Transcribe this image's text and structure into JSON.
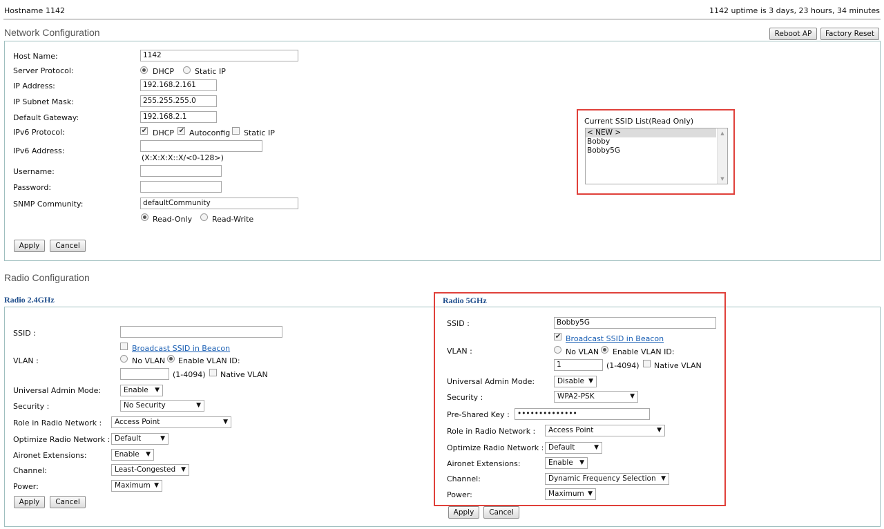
{
  "header": {
    "hostname_label": "Hostname",
    "hostname_value": "1142",
    "uptime": "1142 uptime is 3 days, 23 hours, 34 minutes"
  },
  "network": {
    "title": "Network Configuration",
    "reboot_label": "Reboot AP",
    "factory_reset_label": "Factory Reset",
    "host_name_label": "Host Name:",
    "host_name_value": "1142",
    "server_protocol_label": "Server Protocol:",
    "dhcp_label": "DHCP",
    "static_ip_label": "Static IP",
    "ip_address_label": "IP Address:",
    "ip_address_value": "192.168.2.161",
    "subnet_label": "IP Subnet Mask:",
    "subnet_value": "255.255.255.0",
    "gateway_label": "Default Gateway:",
    "gateway_value": "192.168.2.1",
    "ipv6_protocol_label": "IPv6 Protocol:",
    "ipv6_dhcp_label": "DHCP",
    "ipv6_autoconfig_label": "Autoconfig",
    "ipv6_static_label": "Static IP",
    "ipv6_address_label": "IPv6 Address:",
    "ipv6_address_value": "",
    "ipv6_hint": "(X:X:X:X::X/<0-128>)",
    "username_label": "Username:",
    "username_value": "",
    "password_label": "Password:",
    "password_value": "",
    "snmp_label": "SNMP Community:",
    "snmp_value": "defaultCommunity",
    "read_only_label": "Read-Only",
    "read_write_label": "Read-Write",
    "apply_label": "Apply",
    "cancel_label": "Cancel",
    "ssid_list_label": "Current SSID List(Read Only)",
    "ssid_list": [
      "< NEW >",
      "Bobby",
      "Bobby5G"
    ]
  },
  "radio": {
    "title": "Radio Configuration",
    "r24": {
      "heading": "Radio 2.4GHz",
      "ssid_label": "SSID :",
      "ssid_value": "",
      "broadcast_label": "Broadcast SSID in Beacon",
      "vlan_label": "VLAN :",
      "no_vlan_label": "No VLAN",
      "enable_vlan_label": "Enable VLAN ID:",
      "vlan_id_value": "",
      "vlan_range": "(1-4094)",
      "native_vlan_label": "Native VLAN",
      "uam_label": "Universal Admin Mode:",
      "uam_value": "Enable",
      "security_label": "Security :",
      "security_value": "No Security",
      "role_label": "Role in Radio Network :",
      "role_value": "Access Point",
      "optimize_label": "Optimize Radio Network :",
      "optimize_value": "Default",
      "aironet_label": "Aironet Extensions:",
      "aironet_value": "Enable",
      "channel_label": "Channel:",
      "channel_value": "Least-Congested",
      "power_label": "Power:",
      "power_value": "Maximum",
      "apply_label": "Apply",
      "cancel_label": "Cancel"
    },
    "r5": {
      "heading": "Radio 5GHz",
      "ssid_label": "SSID :",
      "ssid_value": "Bobby5G",
      "broadcast_label": "Broadcast SSID in Beacon",
      "vlan_label": "VLAN :",
      "no_vlan_label": "No VLAN",
      "enable_vlan_label": "Enable VLAN ID:",
      "vlan_id_value": "1",
      "vlan_range": "(1-4094)",
      "native_vlan_label": "Native VLAN",
      "uam_label": "Universal Admin Mode:",
      "uam_value": "Disable",
      "security_label": "Security :",
      "security_value": "WPA2-PSK",
      "psk_label": "Pre-Shared Key :",
      "psk_value": "••••••••••••••",
      "role_label": "Role in Radio Network :",
      "role_value": "Access Point",
      "optimize_label": "Optimize Radio Network :",
      "optimize_value": "Default",
      "aironet_label": "Aironet Extensions:",
      "aironet_value": "Enable",
      "channel_label": "Channel:",
      "channel_value": "Dynamic Frequency Selection",
      "power_label": "Power:",
      "power_value": "Maximum",
      "apply_label": "Apply",
      "cancel_label": "Cancel"
    }
  },
  "icons": {
    "dropdown": "▼",
    "scroll_up": "▲",
    "scroll_down": "▼"
  },
  "colors": {
    "highlight_box": "#e0403a",
    "panel_border": "#9fbfbf",
    "radio_heading": "#1f4e8c",
    "link": "#1a5fb4"
  }
}
